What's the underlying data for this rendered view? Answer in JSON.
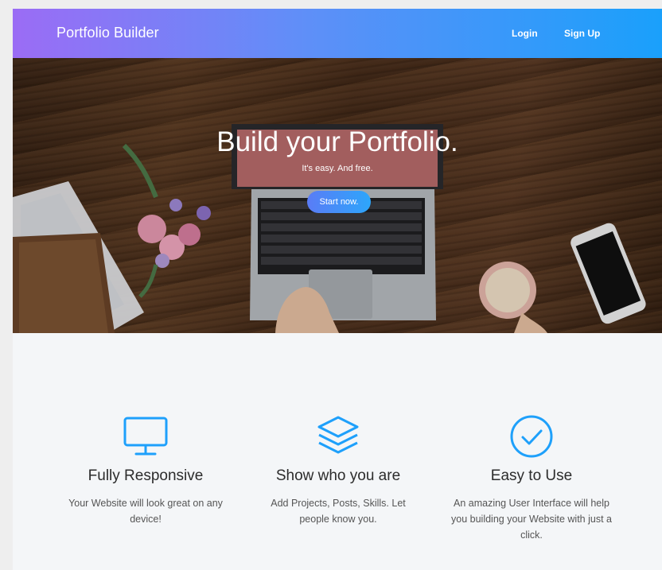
{
  "navbar": {
    "brand": "Portfolio Builder",
    "login": "Login",
    "signup": "Sign Up"
  },
  "hero": {
    "title": "Build your Portfolio.",
    "subtitle": "It's easy. And free.",
    "cta": "Start now."
  },
  "features": [
    {
      "icon": "monitor-icon",
      "title": "Fully Responsive",
      "description": "Your Website will look great on any device!"
    },
    {
      "icon": "layers-icon",
      "title": "Show who you are",
      "description": "Add Projects, Posts, Skills. Let people know you."
    },
    {
      "icon": "check-circle-icon",
      "title": "Easy to Use",
      "description": "An amazing User Interface will help you building your Website with just a click."
    }
  ],
  "colors": {
    "accent": "#1ea0fb",
    "gradient_start": "#9b6cf5",
    "gradient_end": "#1aa0fb"
  }
}
